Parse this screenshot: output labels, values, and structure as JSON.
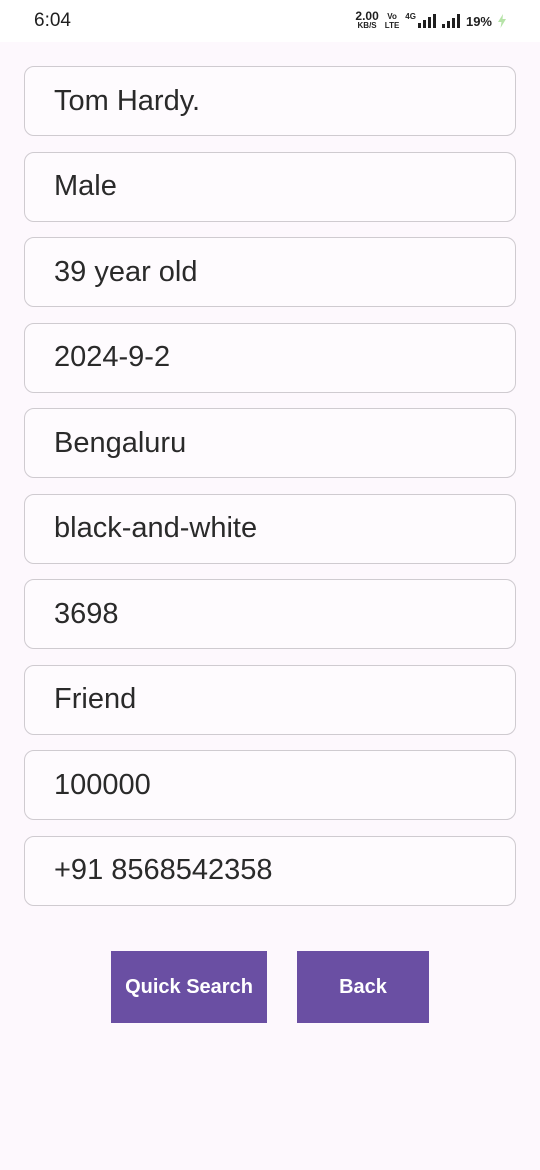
{
  "status_bar": {
    "time": "6:04",
    "speed_value": "2.00",
    "speed_unit": "KB/S",
    "volte_top": "Vo",
    "volte_bottom": "LTE",
    "network_type": "4G",
    "battery": "19%",
    "charge_color": "#b6e3a8"
  },
  "form": {
    "fields": [
      {
        "value": "Tom Hardy."
      },
      {
        "value": "Male"
      },
      {
        "value": "39 year old"
      },
      {
        "value": "2024-9-2"
      },
      {
        "value": "Bengaluru"
      },
      {
        "value": "black-and-white"
      },
      {
        "value": "3698"
      },
      {
        "value": "Friend"
      },
      {
        "value": "100000"
      },
      {
        "value": "+91 8568542358"
      }
    ]
  },
  "actions": {
    "quick_search_label": "Quick Search",
    "back_label": "Back"
  },
  "colors": {
    "accent": "#6a4fa3",
    "background": "#fdf8fd",
    "field_border": "#cfcbd0"
  }
}
